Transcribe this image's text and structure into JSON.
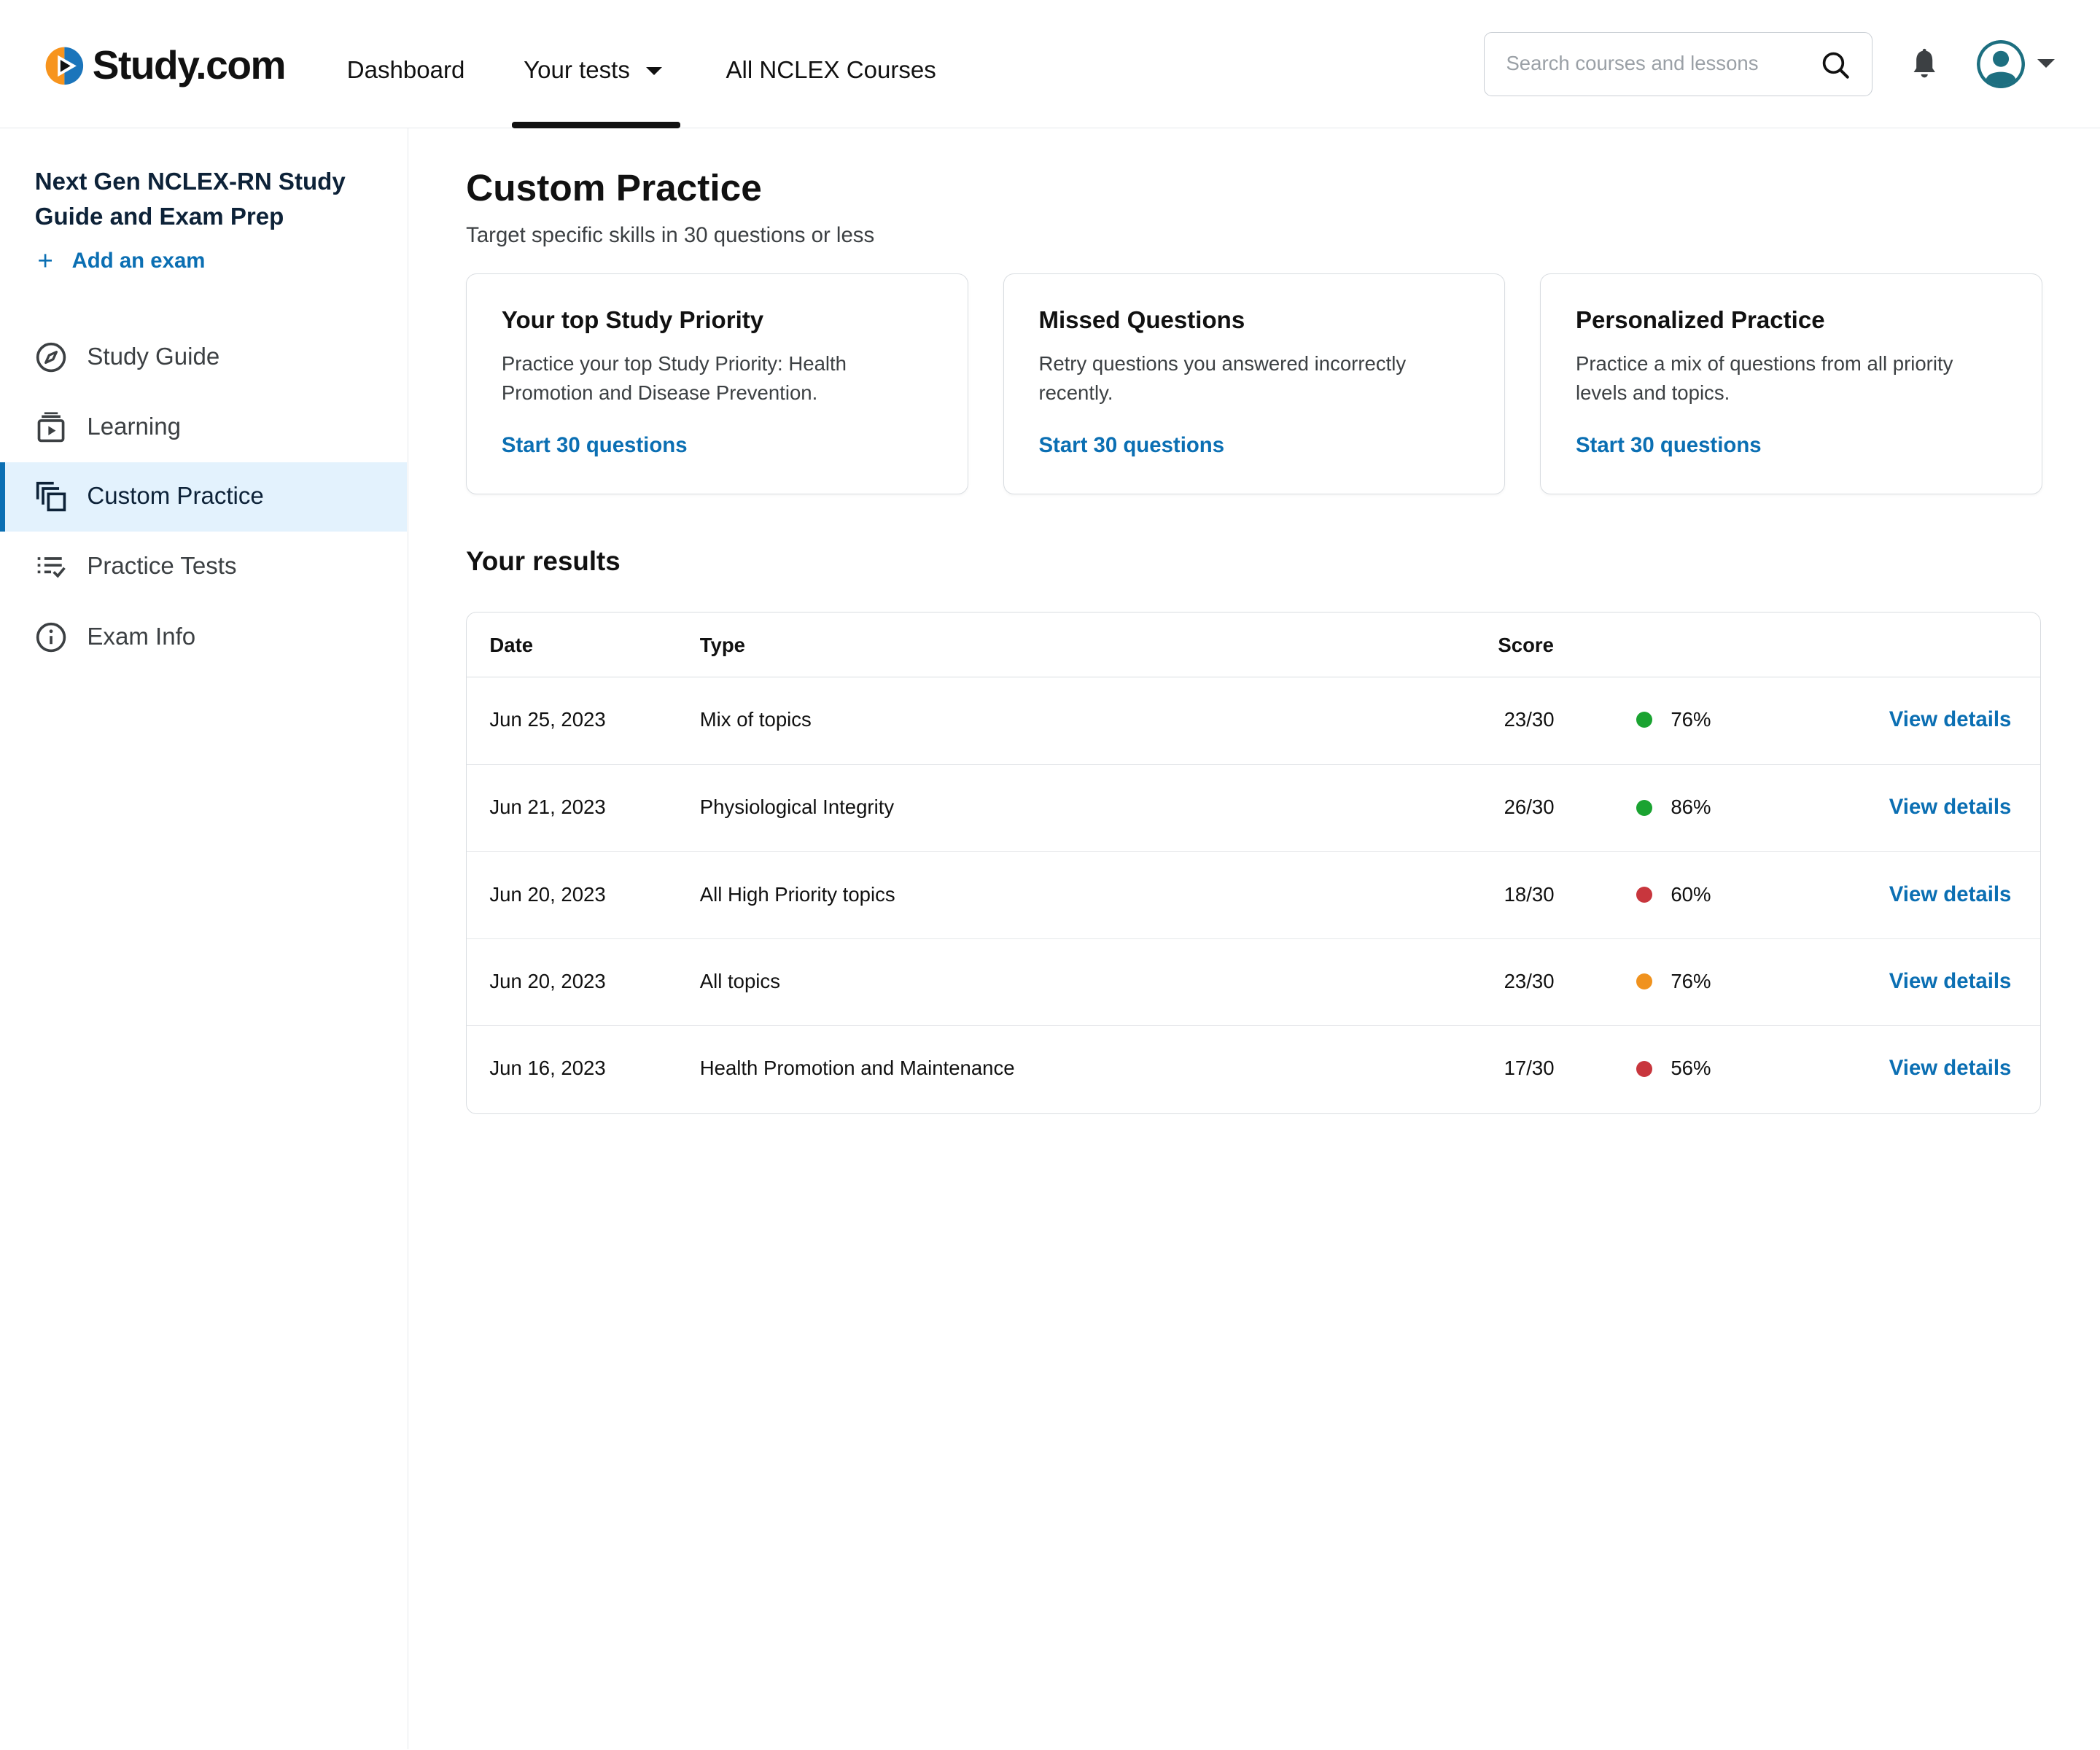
{
  "header": {
    "logo_text": "Study.com",
    "nav": {
      "dashboard": "Dashboard",
      "your_tests": "Your tests",
      "all_courses": "All NCLEX Courses"
    },
    "search_placeholder": "Search courses and lessons",
    "icons": [
      "search-icon",
      "bell-icon",
      "avatar-icon",
      "caret-down-icon"
    ]
  },
  "sidebar": {
    "course_title": "Next Gen NCLEX-RN Study Guide and Exam Prep",
    "add_exam": "Add an exam",
    "items": [
      {
        "label": "Study Guide",
        "icon": "compass-icon"
      },
      {
        "label": "Learning",
        "icon": "video-lesson-icon"
      },
      {
        "label": "Custom Practice",
        "icon": "copy-cards-icon",
        "active": true
      },
      {
        "label": "Practice Tests",
        "icon": "checklist-icon"
      },
      {
        "label": "Exam Info",
        "icon": "info-icon"
      }
    ]
  },
  "main": {
    "title": "Custom Practice",
    "subtitle": "Target specific skills in 30 questions or less",
    "cards": [
      {
        "title": "Your top Study Priority",
        "description": "Practice your top Study Priority: Health Promotion and Disease Prevention.",
        "link": "Start 30 questions"
      },
      {
        "title": "Missed Questions",
        "description": "Retry questions you answered incorrectly recently.",
        "link": "Start 30 questions"
      },
      {
        "title": "Personalized Practice",
        "description": "Practice a mix of questions from all priority levels and topics.",
        "link": "Start 30 questions"
      }
    ],
    "results": {
      "title": "Your results",
      "columns": {
        "date": "Date",
        "type": "Type",
        "score": "Score"
      },
      "rows": [
        {
          "date": "Jun 25, 2023",
          "type": "Mix of topics",
          "score": "23/30",
          "percent": "76%",
          "status_color": "#1aa331",
          "link": "View details"
        },
        {
          "date": "Jun 21, 2023",
          "type": "Physiological Integrity",
          "score": "26/30",
          "percent": "86%",
          "status_color": "#1aa331",
          "link": "View details"
        },
        {
          "date": "Jun 20, 2023",
          "type": "All High Priority topics",
          "score": "18/30",
          "percent": "60%",
          "status_color": "#c8363d",
          "link": "View details"
        },
        {
          "date": "Jun 20, 2023",
          "type": "All topics",
          "score": "23/30",
          "percent": "76%",
          "status_color": "#f0921e",
          "link": "View details"
        },
        {
          "date": "Jun 16, 2023",
          "type": "Health Promotion and Maintenance",
          "score": "17/30",
          "percent": "56%",
          "status_color": "#c8363d",
          "link": "View details"
        }
      ]
    }
  },
  "colors": {
    "accent": "#0b6fb3",
    "active_bg": "#e3f2fd",
    "logo_orange": "#f7941d",
    "logo_blue": "#1b75bb",
    "avatar": "#1d6f80"
  }
}
